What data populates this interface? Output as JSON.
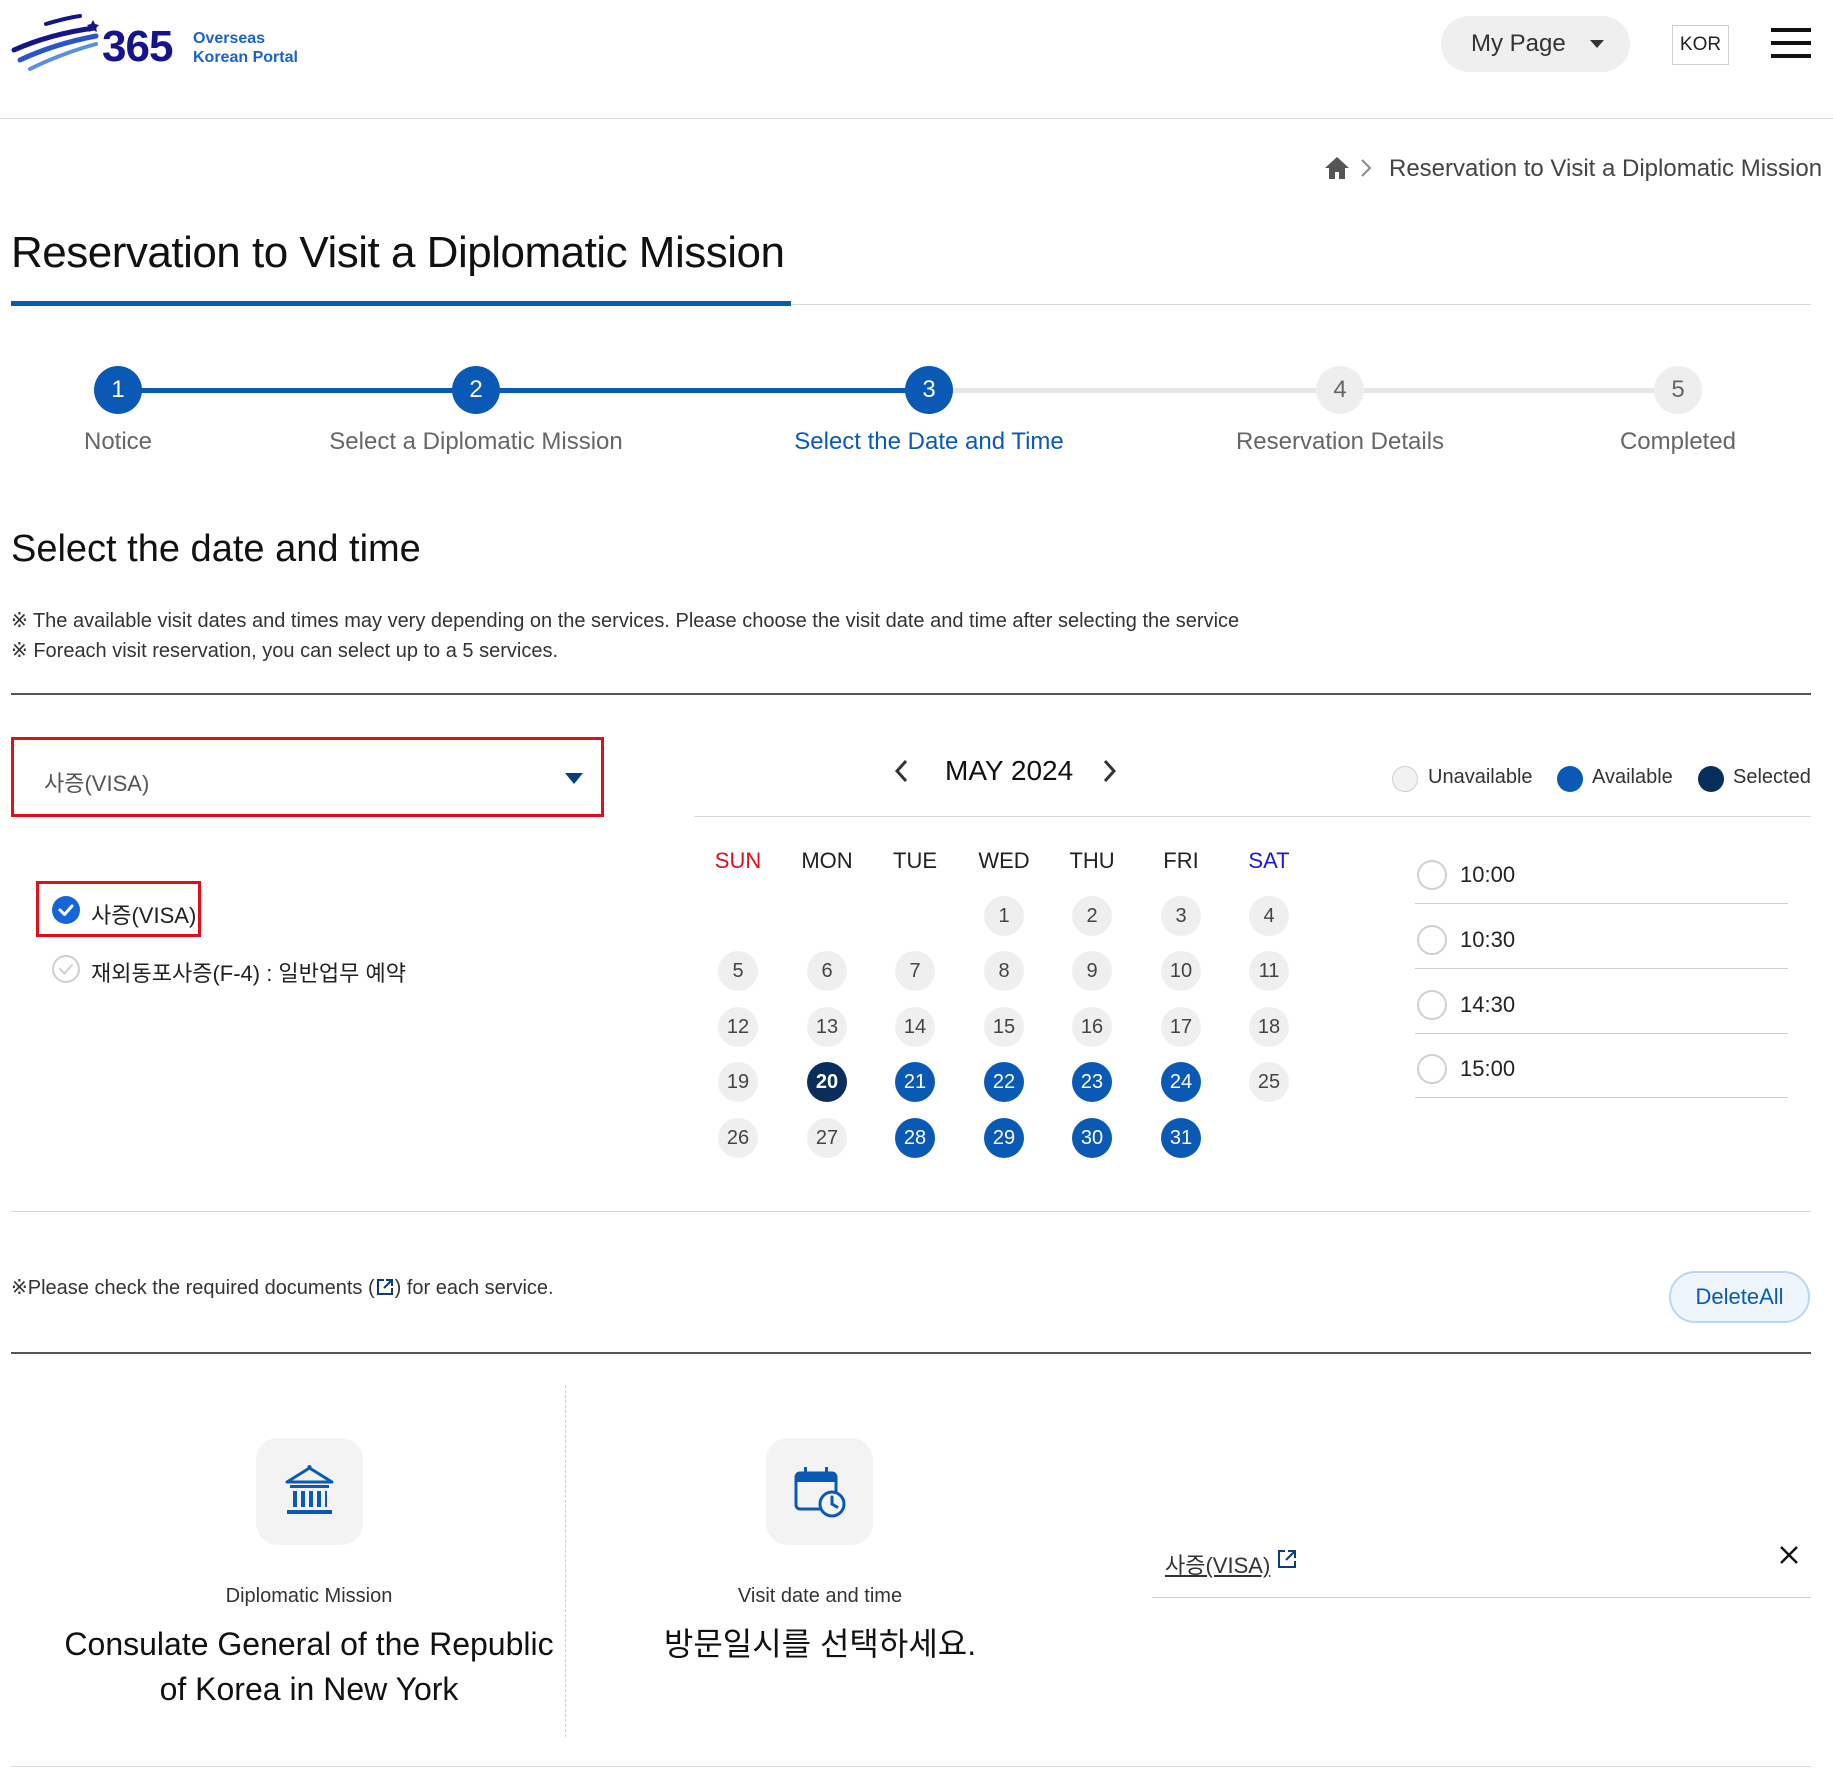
{
  "header": {
    "logo_number": "365",
    "logo_line1": "Overseas",
    "logo_line2": "Korean Portal",
    "mypage_label": "My Page",
    "lang_label": "KOR"
  },
  "breadcrumb": {
    "current": "Reservation to Visit a Diplomatic Mission"
  },
  "page_title": "Reservation to Visit a Diplomatic Mission",
  "steps": [
    {
      "num": "1",
      "label": "Notice",
      "state": "done"
    },
    {
      "num": "2",
      "label": "Select a Diplomatic Mission",
      "state": "done"
    },
    {
      "num": "3",
      "label": "Select the Date and Time",
      "state": "current"
    },
    {
      "num": "4",
      "label": "Reservation Details",
      "state": "todo"
    },
    {
      "num": "5",
      "label": "Completed",
      "state": "todo"
    }
  ],
  "section_title": "Select the date and time",
  "notes": [
    "※ The available visit dates and times may very depending on the services. Please choose the visit date and time after selecting the service",
    "※ Foreach visit reservation, you can select up to a 5 services."
  ],
  "service_select": {
    "value": "사증(VISA)",
    "options": [
      {
        "label": "사증(VISA)",
        "checked": true
      },
      {
        "label": "재외동포사증(F-4) : 일반업무 예약",
        "checked": false
      }
    ]
  },
  "calendar": {
    "month_label": "MAY 2024",
    "weekdays": [
      "SUN",
      "MON",
      "TUE",
      "WED",
      "THU",
      "FRI",
      "SAT"
    ],
    "weekday_colors": [
      "#e0101a",
      "#222222",
      "#222222",
      "#222222",
      "#222222",
      "#222222",
      "#1a1ad8"
    ],
    "weeks": [
      [
        null,
        null,
        null,
        1,
        2,
        3,
        4
      ],
      [
        5,
        6,
        7,
        8,
        9,
        10,
        11
      ],
      [
        12,
        13,
        14,
        15,
        16,
        17,
        18
      ],
      [
        19,
        20,
        21,
        22,
        23,
        24,
        25
      ],
      [
        26,
        27,
        28,
        29,
        30,
        31,
        null
      ]
    ],
    "available_days": [
      21,
      22,
      23,
      24,
      28,
      29,
      30,
      31
    ],
    "selected_day": 20
  },
  "legend": {
    "unavailable": "Unavailable",
    "available": "Available",
    "selected": "Selected"
  },
  "colors": {
    "primary": "#0a5ab5",
    "selected": "#0a2d5c",
    "highlight_border": "#e0101a"
  },
  "times": [
    "10:00",
    "10:30",
    "14:30",
    "15:00"
  ],
  "docs_note_before": "※Please check the required documents (",
  "docs_note_after": ") for each service.",
  "delete_all_label": "DeleteAll",
  "summary": {
    "mission_label": "Diplomatic Mission",
    "mission_line1": "Consulate General of the Republic",
    "mission_line2": "of Korea in New York",
    "datetime_label": "Visit date and time",
    "datetime_value": "방문일시를 선택하세요.",
    "selected_service": "사증(VISA)"
  }
}
